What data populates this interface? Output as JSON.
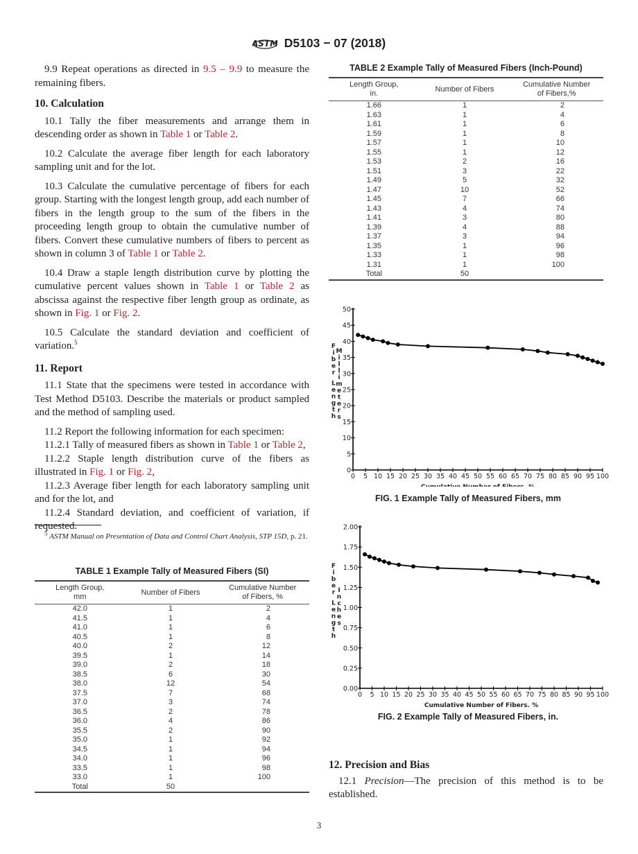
{
  "header": {
    "logo": "astm-logo-icon",
    "designation": "D5103 − 07 (2018)"
  },
  "left": {
    "p99": {
      "pre": "9.9  Repeat operations as directed in ",
      "link": "9.5 – 9.9",
      "post": " to measure the remaining fibers."
    },
    "s10_heading": "10.  Calculation",
    "p101": {
      "pre": "10.1  Tally the fiber measurements and arrange them in descending order as shown in ",
      "link1": "Table 1",
      "mid": " or ",
      "link2": "Table 2",
      "post": "."
    },
    "p102": "10.2  Calculate the average fiber length for each laboratory sampling unit and for the lot.",
    "p103": {
      "pre": "10.3  Calculate the cumulative percentage of fibers for each group. Starting with the longest length group, add each number of fibers in the length group to the sum of the fibers in the proceeding length group to obtain the cumulative number of fibers. Convert these cumulative numbers of fibers to percent as shown in column 3 of ",
      "link1": "Table 1",
      "mid": " or ",
      "link2": "Table 2",
      "post": "."
    },
    "p104": {
      "pre": "10.4  Draw a staple length distribution curve by plotting the cumulative percent values shown in ",
      "link1": "Table 1",
      "mid": " or ",
      "link2": "Table 2",
      "mid2": " as abscissa against the respective fiber length group as ordinate, as shown in ",
      "link3": "Fig. 1",
      "mid3": " or ",
      "link4": "Fig. 2",
      "post": "."
    },
    "p105": {
      "text": "10.5  Calculate the standard deviation and coefficient of variation.",
      "sup": "5"
    },
    "s11_heading": "11.  Report",
    "p111": "11.1  State that the specimens were tested in accordance with Test Method D5103. Describe the materials or product sampled and the method of sampling used.",
    "p112": "11.2  Report the following information for each specimen:",
    "p1121": {
      "pre": "11.2.1  Tally of measured fibers as shown in ",
      "link1": "Table 1",
      "mid": " or ",
      "link2": "Table 2",
      "post": ","
    },
    "p1122": {
      "pre": "11.2.2  Staple length distribution curve of the fibers as illustrated in ",
      "link1": "Fig. 1",
      "mid": " or ",
      "link2": "Fig. 2",
      "post": ","
    },
    "p1123": "11.2.3  Average fiber length for each laboratory sampling unit and for the lot, and",
    "p1124": "11.2.4  Standard deviation, and coefficient of variation, if requested.",
    "footnote": {
      "mark": "5",
      "text": "ASTM Manual on Presentation of Data and Control Chart Analysis, STP 15D",
      "post": ", p. 21."
    }
  },
  "table1": {
    "title": "TABLE 1 Example Tally of Measured Fibers (SI)",
    "headers": [
      "Length Group,\nmm",
      "Number of Fibers",
      "Cumulative Number\nof Fibers, %"
    ],
    "rows": [
      [
        "42.0",
        "1",
        "2"
      ],
      [
        "41.5",
        "1",
        "4"
      ],
      [
        "41.0",
        "1",
        "6"
      ],
      [
        "40.5",
        "1",
        "8"
      ],
      [
        "40.0",
        "2",
        "12"
      ],
      [
        "39.5",
        "1",
        "14"
      ],
      [
        "39.0",
        "2",
        "18"
      ],
      [
        "38.5",
        "6",
        "30"
      ],
      [
        "38.0",
        "12",
        "54"
      ],
      [
        "37.5",
        "7",
        "68"
      ],
      [
        "37.0",
        "3",
        "74"
      ],
      [
        "36.5",
        "2",
        "78"
      ],
      [
        "36.0",
        "4",
        "86"
      ],
      [
        "35.5",
        "2",
        "90"
      ],
      [
        "35.0",
        "1",
        "92"
      ],
      [
        "34.5",
        "1",
        "94"
      ],
      [
        "34.0",
        "1",
        "96"
      ],
      [
        "33.5",
        "1",
        "98"
      ],
      [
        "33.0",
        "1",
        "100"
      ],
      [
        "Total",
        "50",
        ""
      ]
    ]
  },
  "table2": {
    "title": "TABLE 2 Example Tally of Measured Fibers (Inch-Pound)",
    "headers": [
      "Length Group,\nin.",
      "Number of Fibers",
      "Cumulative Number\nof Fibers,%"
    ],
    "rows": [
      [
        "1.66",
        "1",
        "2"
      ],
      [
        "1.63",
        "1",
        "4"
      ],
      [
        "1.61",
        "1",
        "6"
      ],
      [
        "1.59",
        "1",
        "8"
      ],
      [
        "1.57",
        "1",
        "10"
      ],
      [
        "1.55",
        "1",
        "12"
      ],
      [
        "1.53",
        "2",
        "16"
      ],
      [
        "1.51",
        "3",
        "22"
      ],
      [
        "1.49",
        "5",
        "32"
      ],
      [
        "1.47",
        "10",
        "52"
      ],
      [
        "1.45",
        "7",
        "66"
      ],
      [
        "1.43",
        "4",
        "74"
      ],
      [
        "1.41",
        "3",
        "80"
      ],
      [
        "1.39",
        "4",
        "88"
      ],
      [
        "1.37",
        "3",
        "94"
      ],
      [
        "1.35",
        "1",
        "96"
      ],
      [
        "1.33",
        "1",
        "98"
      ],
      [
        "1.31",
        "1",
        "100"
      ],
      [
        "Total",
        "50",
        ""
      ]
    ]
  },
  "right": {
    "s12_heading": "12.  Precision and Bias",
    "p121": {
      "num": "12.1 ",
      "italic": "Precision",
      "post": "—The precision of this method is to be established."
    }
  },
  "page_number": "3",
  "chart_data": [
    {
      "type": "line",
      "caption": "FIG. 1  Example Tally of Measured Fibers, mm",
      "xlabel": "Cumulative Number of Fibers, %",
      "ylabel_outer": "Fiber Length",
      "ylabel_inner": "Millimeters",
      "xlim": [
        0,
        100
      ],
      "ylim": [
        0,
        50
      ],
      "xticks": [
        0,
        5,
        10,
        15,
        20,
        25,
        30,
        35,
        40,
        45,
        50,
        55,
        60,
        65,
        70,
        75,
        80,
        85,
        90,
        95,
        100
      ],
      "yticks": [
        "0",
        "5",
        "10",
        "15",
        "20",
        "25",
        "30",
        "35",
        "40",
        "45",
        "50"
      ],
      "ytick_values": [
        0,
        5,
        10,
        15,
        20,
        25,
        30,
        35,
        40,
        45,
        50
      ],
      "grid": false,
      "series": [
        {
          "name": "mm",
          "x": [
            2,
            4,
            6,
            8,
            12,
            14,
            18,
            30,
            54,
            68,
            74,
            78,
            86,
            90,
            92,
            94,
            96,
            98,
            100
          ],
          "y": [
            42.0,
            41.5,
            41.0,
            40.5,
            40.0,
            39.5,
            39.0,
            38.5,
            38.0,
            37.5,
            37.0,
            36.5,
            36.0,
            35.5,
            35.0,
            34.5,
            34.0,
            33.5,
            33.0
          ]
        }
      ]
    },
    {
      "type": "line",
      "caption": "FIG. 2  Example Tally of Measured Fibers, in.",
      "xlabel": "Cumulative Number of Fibers, %",
      "ylabel_outer": "Fiber Length",
      "ylabel_inner": "Inches",
      "xlim": [
        0,
        100
      ],
      "ylim": [
        0,
        2
      ],
      "xticks": [
        0,
        5,
        10,
        15,
        20,
        25,
        30,
        35,
        40,
        45,
        50,
        55,
        60,
        65,
        70,
        75,
        80,
        85,
        90,
        95,
        100
      ],
      "yticks": [
        "0.00",
        "0.25",
        "0.50",
        "0.75",
        "1.00",
        "1.25",
        "1.50",
        "1.75",
        "2.00"
      ],
      "ytick_values": [
        0,
        0.25,
        0.5,
        0.75,
        1.0,
        1.25,
        1.5,
        1.75,
        2.0
      ],
      "grid": false,
      "series": [
        {
          "name": "in",
          "x": [
            2,
            4,
            6,
            8,
            10,
            12,
            16,
            22,
            32,
            52,
            66,
            74,
            80,
            88,
            94,
            96,
            98
          ],
          "y": [
            1.66,
            1.63,
            1.61,
            1.59,
            1.57,
            1.55,
            1.53,
            1.51,
            1.49,
            1.47,
            1.45,
            1.43,
            1.41,
            1.39,
            1.37,
            1.33,
            1.31
          ]
        }
      ]
    }
  ]
}
